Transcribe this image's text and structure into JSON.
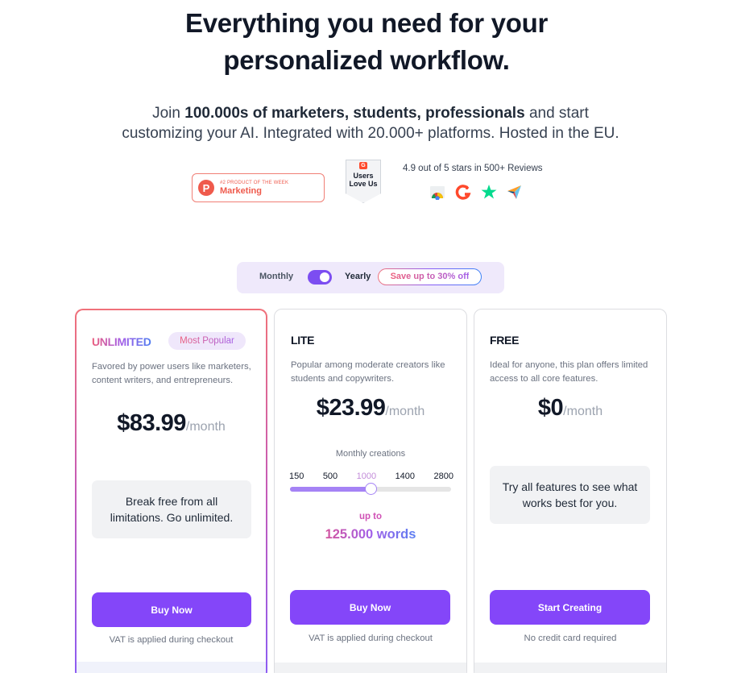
{
  "hero": {
    "title_line1": "Everything you need for your",
    "title_line2": "personalized workflow.",
    "sub_prefix": "Join ",
    "sub_bold": "100.000s of marketers, students, professionals",
    "sub_suffix": " and start",
    "sub_line2": "customizing your AI. Integrated with 20.000+ platforms. Hosted in the EU."
  },
  "badges": {
    "product_hunt": {
      "logo": "P",
      "small": "#2 PRODUCT OF THE WEEK",
      "big": "Marketing"
    },
    "g2": {
      "logo": "G",
      "text_line1": "Users",
      "text_line2": "Love Us"
    },
    "reviews_text": "4.9 out of 5 stars in 500+ Reviews",
    "review_icons": [
      "chrome-web-store-icon",
      "g2-icon",
      "trustpilot-star-icon",
      "capterra-icon"
    ]
  },
  "billing_toggle": {
    "monthly_label": "Monthly",
    "yearly_label": "Yearly",
    "selected": "Yearly",
    "save_label": "Save up to 30% off"
  },
  "colors": {
    "accent": "#8446f9",
    "toggle_bg": "#efe9fb",
    "note_bg": "#f1f2f4",
    "title": "#111827"
  },
  "plans": [
    {
      "name": "UNLIMITED",
      "badge": "Most Popular",
      "description": "Favored by power users like marketers, content writers, and entrepreneurs.",
      "price": "$83.99",
      "period": "/month",
      "note": "Break free from all limitations. Go unlimited.",
      "cta": "Buy Now",
      "cta_note": "VAT is applied during checkout"
    },
    {
      "name": "LITE",
      "description": "Popular among moderate creators like students and copywriters.",
      "price": "$23.99",
      "period": "/month",
      "slider": {
        "label": "Monthly creations",
        "ticks": [
          "150",
          "500",
          "1000",
          "1400",
          "2800"
        ],
        "selected_index": 2,
        "selected_value": "1000",
        "progress_fraction": 0.5
      },
      "upto_label": "up to",
      "words": "125.000 words",
      "cta": "Buy Now",
      "cta_note": "VAT is applied during checkout"
    },
    {
      "name": "FREE",
      "description": "Ideal for anyone, this plan offers limited access to all core features.",
      "price": "$0",
      "period": "/month",
      "note": "Try all features to see what works best for you.",
      "cta": "Start Creating",
      "cta_note": "No credit card required"
    }
  ]
}
